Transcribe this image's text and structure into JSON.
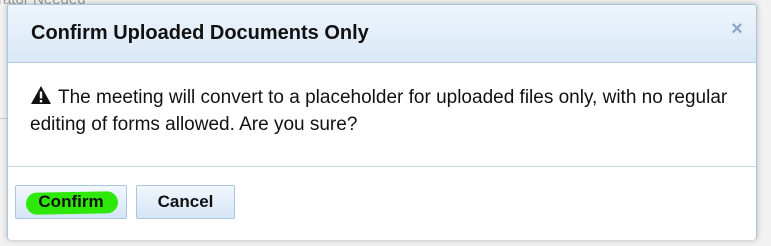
{
  "background": {
    "partial_text": "rator Needed"
  },
  "dialog": {
    "title": "Confirm Uploaded Documents Only",
    "close_symbol": "×",
    "message_icon": "warning-triangle-icon",
    "message": "The meeting will convert to a placeholder for uploaded files only, with no regular editing of forms allowed. Are you sure?",
    "buttons": {
      "confirm_label": "Confirm",
      "cancel_label": "Cancel"
    }
  },
  "colors": {
    "titlebar": "#d9e8f7",
    "button": "#d4e5f6",
    "highlight": "#2ee80a"
  }
}
